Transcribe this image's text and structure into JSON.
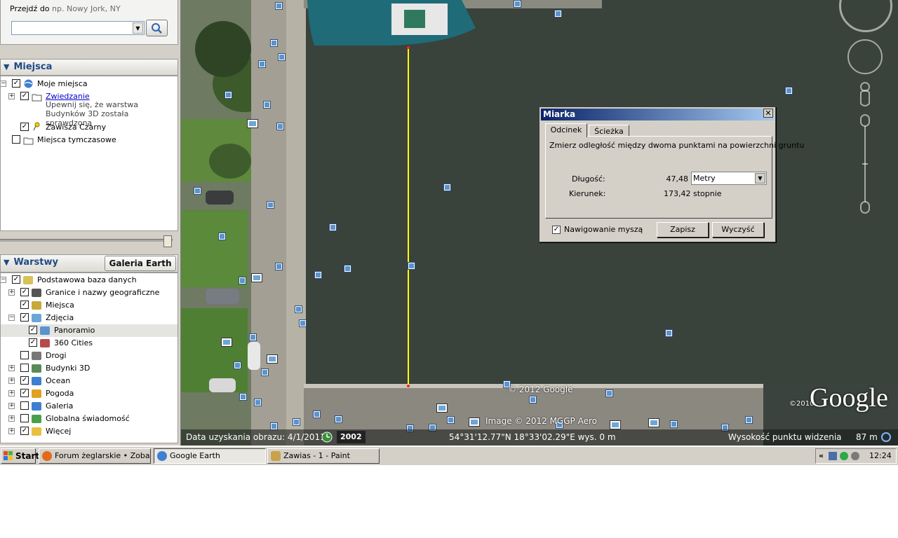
{
  "search": {
    "label": "Przejdź do",
    "placeholder": "np. Nowy Jork, NY",
    "value": ""
  },
  "places": {
    "header": "Miejsca",
    "items": [
      {
        "label": "Moje miejsca"
      },
      {
        "label": "Zwiedzanie",
        "note": "Upewnij się, że warstwa Budynków 3D została sprawdzona"
      },
      {
        "label": "Zawisza Czarny"
      },
      {
        "label": "Miejsca tymczasowe"
      }
    ]
  },
  "layers": {
    "header": "Warstwy",
    "gallery_button": "Galeria Earth",
    "items": [
      {
        "label": "Podstawowa baza danych",
        "checked": true
      },
      {
        "label": "Granice i nazwy geograficzne",
        "checked": true
      },
      {
        "label": "Miejsca",
        "checked": true
      },
      {
        "label": "Zdjęcia",
        "checked": true
      },
      {
        "label": "Panoramio",
        "checked": true
      },
      {
        "label": "360 Cities",
        "checked": true
      },
      {
        "label": "Drogi",
        "checked": false
      },
      {
        "label": "Budynki 3D",
        "checked": false
      },
      {
        "label": "Ocean",
        "checked": true
      },
      {
        "label": "Pogoda",
        "checked": true
      },
      {
        "label": "Galeria",
        "checked": false
      },
      {
        "label": "Globalna świadomość",
        "checked": false
      },
      {
        "label": "Więcej",
        "checked": true
      }
    ]
  },
  "map": {
    "copyright_google": "© 2012 Google",
    "copyright_image": "Image © 2012 MGGP Aero",
    "logo": "Google",
    "logo_year": "©2010",
    "status": {
      "date_label": "Data uzyskania obrazu: 4/1/2011",
      "year": "2002",
      "coords": "54°31'12.77\"N  18°33'02.29\"E  wys.   0 m",
      "eye_alt_label": "Wysokość punktu widzenia",
      "eye_alt_value": "87 m"
    }
  },
  "dialog": {
    "title": "Miarka",
    "tabs": [
      "Odcinek",
      "Ścieżka"
    ],
    "description": "Zmierz odległość między dwoma punktami na powierzchni gruntu",
    "length_label": "Długość:",
    "length_value": "47,48",
    "unit": "Metry",
    "heading_label": "Kierunek:",
    "heading_value": "173,42 stopnie",
    "mouse_nav_label": "Nawigowanie myszą",
    "mouse_nav_checked": true,
    "save_button": "Zapisz",
    "clear_button": "Wyczyść"
  },
  "taskbar": {
    "start": "Start",
    "tasks": [
      {
        "label": "Forum żeglarskie • Zobac..."
      },
      {
        "label": "Google Earth",
        "active": true
      },
      {
        "label": "Zawias - 1 - Paint"
      }
    ],
    "tray_chevron": "«",
    "time": "12:24"
  },
  "colors": {
    "title_bar": "#0a246a",
    "measure_line": "#ffff00",
    "water": "#3a433d",
    "link": "#0000cc"
  }
}
